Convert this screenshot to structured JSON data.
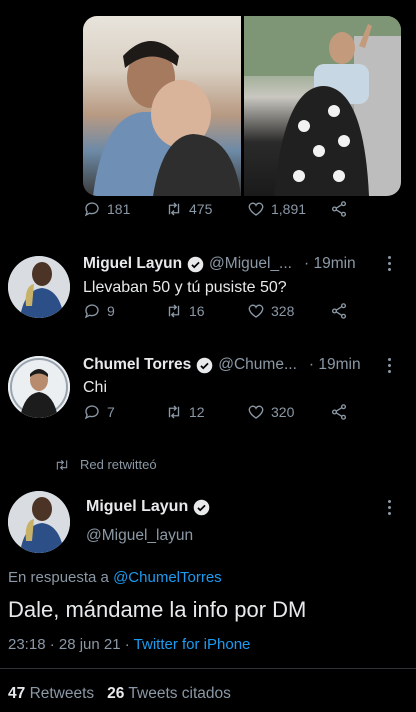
{
  "top_tweet": {
    "replies": "181",
    "retweets": "475",
    "likes": "1,891"
  },
  "reply1": {
    "name": "Miguel Layun",
    "handle": "@Miguel_...",
    "time": "· 19min",
    "text": "Llevaban 50 y tú pusiste 50?",
    "replies": "9",
    "retweets": "16",
    "likes": "328"
  },
  "reply2": {
    "name": "Chumel Torres",
    "handle": "@Chume...",
    "time": "· 19min",
    "text": "Chi",
    "replies": "7",
    "retweets": "12",
    "likes": "320"
  },
  "retweeted_by": "Red retwitteó",
  "main": {
    "name": "Miguel Layun",
    "handle": "@Miguel_layun",
    "reply_prefix": "En respuesta a",
    "reply_mention": "@ChumelTorres",
    "text": "Dale, mándame la info por DM",
    "timestamp": "23:18 · 28 jun 21 ·",
    "source": "Twitter for iPhone",
    "retweets_count": "47",
    "retweets_label": "Retweets",
    "quotes_count": "26",
    "quotes_label": "Tweets citados"
  },
  "colors": {
    "background": "#000000",
    "text": "#e7e9ea",
    "muted": "#8b98a5",
    "accent": "#1d9bf0"
  }
}
